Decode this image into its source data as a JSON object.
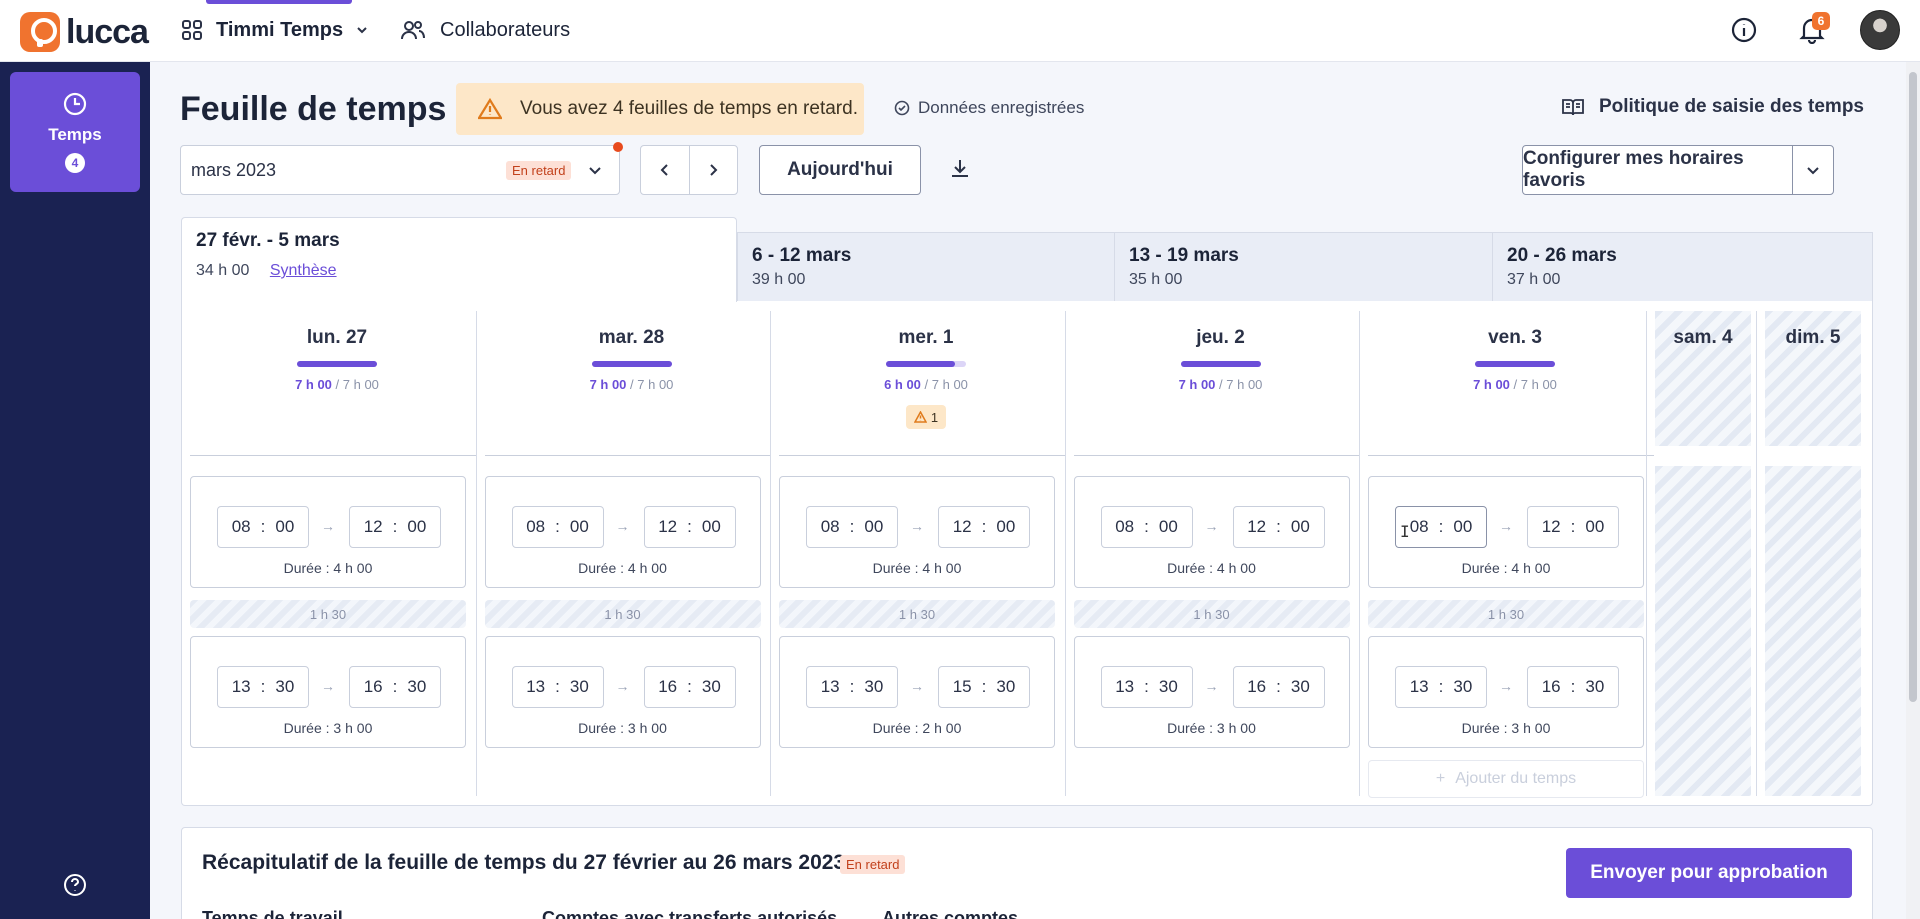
{
  "topbar": {
    "logo_text": "lucca",
    "app_name": "Timmi Temps",
    "collab_label": "Collaborateurs",
    "notifications_count": "6"
  },
  "sidebar": {
    "item_label": "Temps",
    "item_badge": "4"
  },
  "page": {
    "title": "Feuille de temps",
    "alert": "Vous avez 4 feuilles de temps en retard.",
    "saved": "Données enregistrées",
    "policy": "Politique de saisie des temps"
  },
  "toolbar": {
    "month": "mars 2023",
    "month_status": "En retard",
    "today_label": "Aujourd'hui",
    "favorites_label": "Configurer mes horaires favoris"
  },
  "weeks": [
    {
      "title": "27 févr. - 5 mars",
      "total": "34 h 00",
      "link": "Synthèse"
    },
    {
      "title": "6 - 12 mars",
      "total": "39 h 00"
    },
    {
      "title": "13 - 19 mars",
      "total": "35 h 00"
    },
    {
      "title": "20 - 26 mars",
      "total": "37 h 00"
    }
  ],
  "days": [
    {
      "label": "lun. 27",
      "done": "7 h 00",
      "target": "/ 7 h 00",
      "progress": 1.0,
      "morning": {
        "sh": "08",
        "sm": "00",
        "eh": "12",
        "em": "00",
        "duration": "Durée : 4 h 00"
      },
      "break": "1 h 30",
      "afternoon": {
        "sh": "13",
        "sm": "30",
        "eh": "16",
        "em": "30",
        "duration": "Durée : 3 h 00"
      }
    },
    {
      "label": "mar. 28",
      "done": "7 h 00",
      "target": "/ 7 h 00",
      "progress": 1.0,
      "morning": {
        "sh": "08",
        "sm": "00",
        "eh": "12",
        "em": "00",
        "duration": "Durée : 4 h 00"
      },
      "break": "1 h 30",
      "afternoon": {
        "sh": "13",
        "sm": "30",
        "eh": "16",
        "em": "30",
        "duration": "Durée : 3 h 00"
      }
    },
    {
      "label": "mer. 1",
      "done": "6 h 00",
      "target": "/ 7 h 00",
      "progress": 0.857,
      "warning": "1",
      "morning": {
        "sh": "08",
        "sm": "00",
        "eh": "12",
        "em": "00",
        "duration": "Durée : 4 h 00"
      },
      "break": "1 h 30",
      "afternoon": {
        "sh": "13",
        "sm": "30",
        "eh": "15",
        "em": "30",
        "duration": "Durée : 2 h 00"
      }
    },
    {
      "label": "jeu. 2",
      "done": "7 h 00",
      "target": "/ 7 h 00",
      "progress": 1.0,
      "morning": {
        "sh": "08",
        "sm": "00",
        "eh": "12",
        "em": "00",
        "duration": "Durée : 4 h 00"
      },
      "break": "1 h 30",
      "afternoon": {
        "sh": "13",
        "sm": "30",
        "eh": "16",
        "em": "30",
        "duration": "Durée : 3 h 00"
      }
    },
    {
      "label": "ven. 3",
      "done": "7 h 00",
      "target": "/ 7 h 00",
      "progress": 1.0,
      "morning": {
        "sh": "08",
        "sm": "00",
        "eh": "12",
        "em": "00",
        "duration": "Durée : 4 h 00"
      },
      "break": "1 h 30",
      "afternoon": {
        "sh": "13",
        "sm": "30",
        "eh": "16",
        "em": "30",
        "duration": "Durée : 3 h 00"
      },
      "add_time": "Ajouter du temps"
    }
  ],
  "weekend": [
    {
      "label": "sam. 4"
    },
    {
      "label": "dim. 5"
    }
  ],
  "summary": {
    "title": "Récapitulatif de la feuille de temps du 27 février au 26 mars 2023",
    "status": "En retard",
    "send_label": "Envoyer pour approbation",
    "col1": "Temps de travail",
    "col2": "Comptes avec transferts autorisés",
    "col3": "Autres comptes"
  },
  "colors": {
    "accent": "#6b4ed8",
    "sidebar": "#1a2252",
    "brand": "#f0732f",
    "alert_bg": "#fde7c8",
    "late_bg": "#fde0d6"
  }
}
